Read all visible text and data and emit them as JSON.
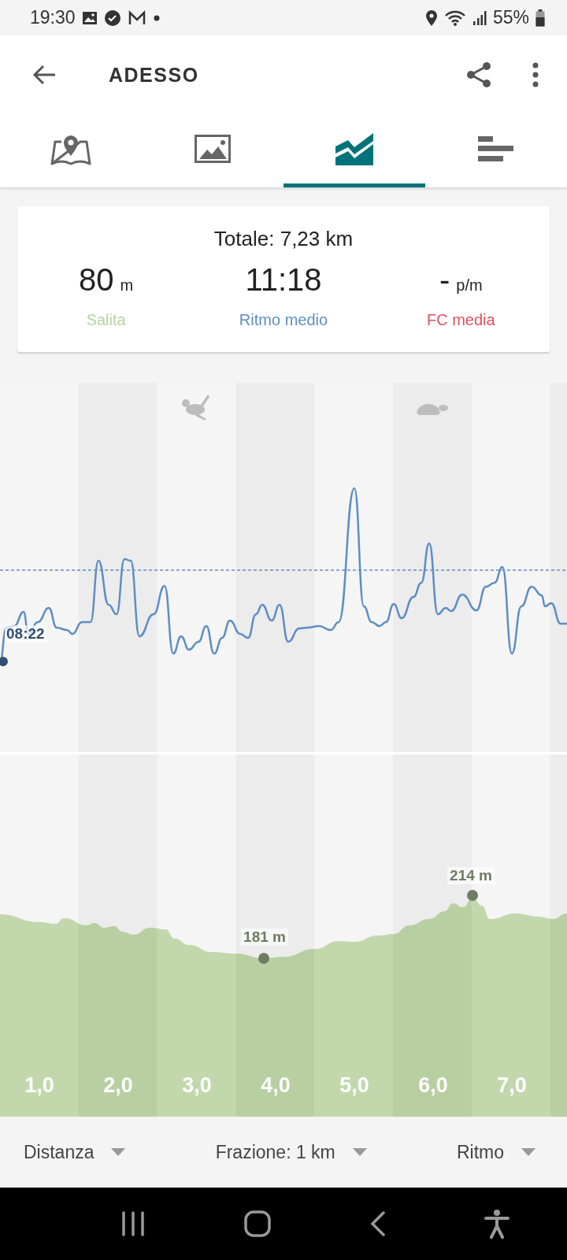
{
  "status_bar": {
    "time": "19:30",
    "battery": "55%"
  },
  "app_bar": {
    "title": "ADESSO"
  },
  "tabs": [
    {
      "kind": "map",
      "selected": false
    },
    {
      "kind": "photos",
      "selected": false
    },
    {
      "kind": "chart",
      "selected": true
    },
    {
      "kind": "laps",
      "selected": false
    }
  ],
  "summary": {
    "total": "Totale: 7,23 km",
    "stats": [
      {
        "value": "80",
        "unit": "m",
        "label": "Salita",
        "color": "#b7d3a0"
      },
      {
        "value": "11:18",
        "label": "Ritmo medio",
        "color": "#5f8dc4"
      },
      {
        "value": "-",
        "unit": "p/m",
        "label": "FC media",
        "color": "#e0505e"
      }
    ]
  },
  "pace_chart": {
    "start_label": "08:22"
  },
  "elevation_chart": {
    "min_label": "181 m",
    "max_label": "214 m",
    "x_labels": [
      "1,0",
      "2,0",
      "3,0",
      "4,0",
      "5,0",
      "6,0",
      "7,0"
    ]
  },
  "footer": {
    "dropdowns": [
      {
        "label": "Distanza"
      },
      {
        "label": "Frazione: 1 km"
      },
      {
        "label": "Ritmo"
      }
    ]
  }
}
